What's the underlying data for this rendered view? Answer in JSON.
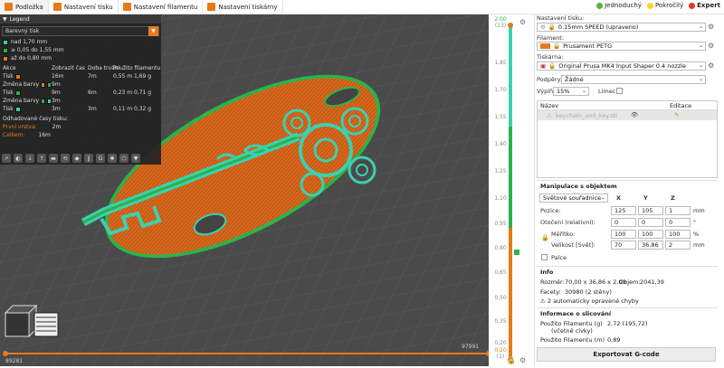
{
  "tabs": [
    {
      "label": "Podložka",
      "icon": "plater-icon",
      "color": "#e67a1a"
    },
    {
      "label": "Nastavení tisku",
      "icon": "print-settings-icon",
      "color": "#e67a1a"
    },
    {
      "label": "Nastavení filamentu",
      "icon": "filament-settings-icon",
      "color": "#e67a1a"
    },
    {
      "label": "Nastavení tiskárny",
      "icon": "printer-settings-icon",
      "color": "#e67a1a"
    }
  ],
  "modes": [
    {
      "label": "Jednoduchý",
      "color": "#5ab13b"
    },
    {
      "label": "Pokročilý",
      "color": "#ffd42a"
    },
    {
      "label": "Expert",
      "color": "#e8332a"
    }
  ],
  "legend": {
    "title": "Legend",
    "view_type": "Barevný tisk",
    "ranges": [
      {
        "label": "nad 1,70 mm",
        "color": "#3cd0b0"
      },
      {
        "label": "≥ 0,05 do 1,55 mm",
        "color": "#2cb24a"
      },
      {
        "label": "až do 0,80 mm",
        "color": "#e67a1a"
      }
    ],
    "headers": {
      "action": "Akce",
      "displayed": "Zobrazit čas",
      "duration": "Doba trvání",
      "usage": "Použito filamentu"
    },
    "actions": [
      {
        "action": "Tisk",
        "swatches": [
          "#e67a1a"
        ],
        "displayed": "16m",
        "duration": "7m",
        "usage": "0,55 m  1,69 g"
      },
      {
        "action": "Změna barvy",
        "swatches": [
          "#e67a1a",
          "#2cb24a"
        ],
        "displayed": "9m",
        "duration": "",
        "usage": ""
      },
      {
        "action": "Tisk",
        "swatches": [
          "#2cb24a"
        ],
        "displayed": "9m",
        "duration": "6m",
        "usage": "0,23 m  0,71 g"
      },
      {
        "action": "Změna barvy",
        "swatches": [
          "#2cb24a",
          "#3cd0b0"
        ],
        "displayed": "3m",
        "duration": "",
        "usage": ""
      },
      {
        "action": "Tisk",
        "swatches": [
          "#3cd0b0"
        ],
        "displayed": "3m",
        "duration": "3m",
        "usage": "0,11 m  0,32 g"
      }
    ],
    "estimated_title": "Odhadované časy tisku:",
    "estimates": [
      {
        "label": "První vrstva:",
        "value": "2m"
      },
      {
        "label": "Celkem:",
        "value": "16m"
      }
    ],
    "toolbar_icons": [
      "travel-icon",
      "wipe-icon",
      "retraction-icon",
      "deretraction-icon",
      "seam-icon",
      "tool-change-icon",
      "color-change-icon",
      "pause-icon",
      "custom-gcode-icon",
      "cog-icon",
      "shells-icon",
      "tool-marker-icon"
    ]
  },
  "hslider": {
    "left": "89281",
    "right": "97991"
  },
  "vslider": {
    "top_value": "2,00",
    "top_index": "(13)",
    "ticks": [
      "1,85",
      "1,70",
      "1,55",
      "1,40",
      "1,25",
      "1,10",
      "0,95",
      "0,80",
      "0,65",
      "0,50",
      "0,35",
      "0,20"
    ],
    "bottom_value": "0,20",
    "bottom_index": "(1)"
  },
  "right_panel": {
    "print_settings_label": "Nastavení tisku:",
    "print_settings_value": "0.15mm SPEED (upraveno)",
    "filament_label": "Filament:",
    "filament_value": "Prusament PETG",
    "filament_color": "#e67a1a",
    "printer_label": "Tiskárna:",
    "printer_value": "Original Prusa MK4 Input Shaper 0.4 nozzle",
    "supports_label": "Podpěry:",
    "supports_value": "Žádné",
    "infill_label": "Výplň:",
    "infill_value": "15%",
    "brim_label": "Límec:",
    "list_headers": {
      "name": "Název",
      "edit": "Editace"
    },
    "object_name": "keychain_and_key.stl",
    "manip_title": "Manipulace s objektem",
    "coord_system": "Světové souřadnice",
    "axes": [
      "X",
      "Y",
      "Z"
    ],
    "position_label": "Pozice:",
    "position": [
      "125",
      "105",
      "1"
    ],
    "position_unit": "mm",
    "rotation_label": "Otočení (relativní):",
    "rotation": [
      "0",
      "0",
      "0"
    ],
    "rotation_unit": "°",
    "scale_label": "Měřítko:",
    "scale": [
      "100",
      "100",
      "100"
    ],
    "scale_unit": "%",
    "size_label": "Velikost [Svět]:",
    "size": [
      "70",
      "36,86",
      "2"
    ],
    "size_unit": "mm",
    "inches_label": "Palce",
    "info_title": "Info",
    "size_info_label": "Rozměr:",
    "size_info_value": "70,00 x 36,86 x 2,00",
    "volume_label": "Objem:",
    "volume_value": "2041,39",
    "facets_label": "Facety:",
    "facets_value": "30980 (2 stěny)",
    "errors_value": "2 automaticky opravené chyby",
    "slice_title": "Informace o slicování",
    "filament_g_label": "Použito Filamentu (g)",
    "filament_g_sub": "(včetně cívky)",
    "filament_g_value": "2,72 (195,72)",
    "filament_m_label": "Použito Filamentu (m)",
    "filament_m_value": "0,89",
    "export_label": "Exportovat G-code"
  }
}
